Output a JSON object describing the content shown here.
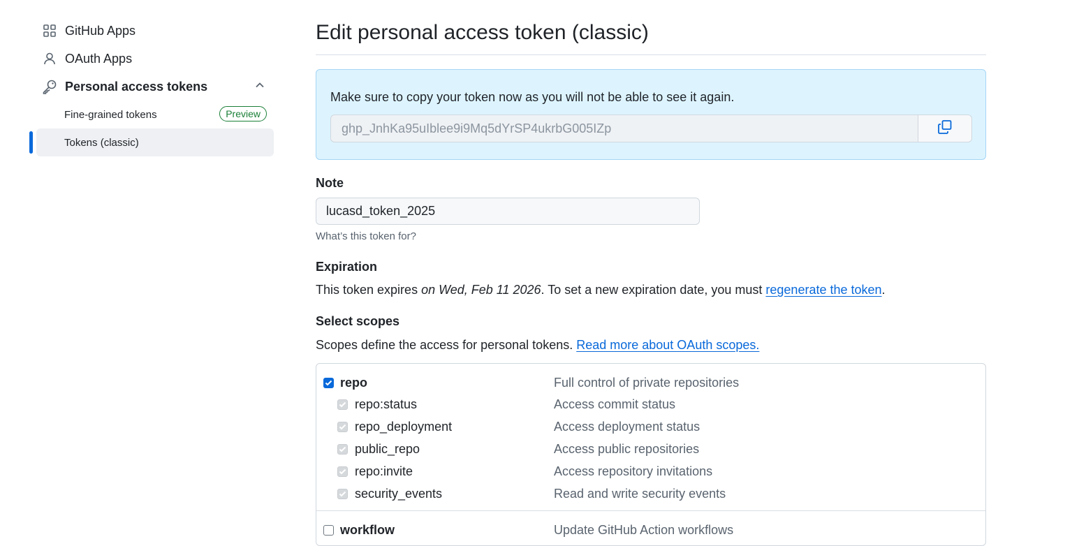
{
  "sidebar": {
    "items": [
      {
        "label": "GitHub Apps",
        "icon": "apps-grid-icon"
      },
      {
        "label": "OAuth Apps",
        "icon": "person-icon"
      },
      {
        "label": "Personal access tokens",
        "icon": "key-icon"
      }
    ],
    "subitems": [
      {
        "label": "Fine-grained tokens",
        "badge": "Preview"
      },
      {
        "label": "Tokens (classic)"
      }
    ]
  },
  "main": {
    "title": "Edit personal access token (classic)",
    "flash": {
      "message": "Make sure to copy your token now as you will not be able to see it again.",
      "token": "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"
    },
    "note": {
      "label": "Note",
      "value": "lucasd_token_2025",
      "hint": "What’s this token for?"
    },
    "expiration": {
      "label": "Expiration",
      "prefix": "This token expires ",
      "date": "on Wed, Feb 11 2026",
      "middle": ". To set a new expiration date, you must ",
      "link": "regenerate the token",
      "suffix": "."
    },
    "scopes": {
      "label": "Select scopes",
      "text": "Scopes define the access for personal tokens. ",
      "link": "Read more about OAuth scopes.",
      "items": [
        {
          "name": "repo",
          "desc": "Full control of private repositories",
          "checked": true
        },
        {
          "name": "repo:status",
          "desc": "Access commit status",
          "checked": true
        },
        {
          "name": "repo_deployment",
          "desc": "Access deployment status",
          "checked": true
        },
        {
          "name": "public_repo",
          "desc": "Access public repositories",
          "checked": true
        },
        {
          "name": "repo:invite",
          "desc": "Access repository invitations",
          "checked": true
        },
        {
          "name": "security_events",
          "desc": "Read and write security events",
          "checked": true
        },
        {
          "name": "workflow",
          "desc": "Update GitHub Action workflows",
          "checked": false
        }
      ]
    }
  },
  "colors": {
    "accent": "#0969da",
    "flash_bg": "#ddf4ff",
    "success": "#1a7f37"
  }
}
